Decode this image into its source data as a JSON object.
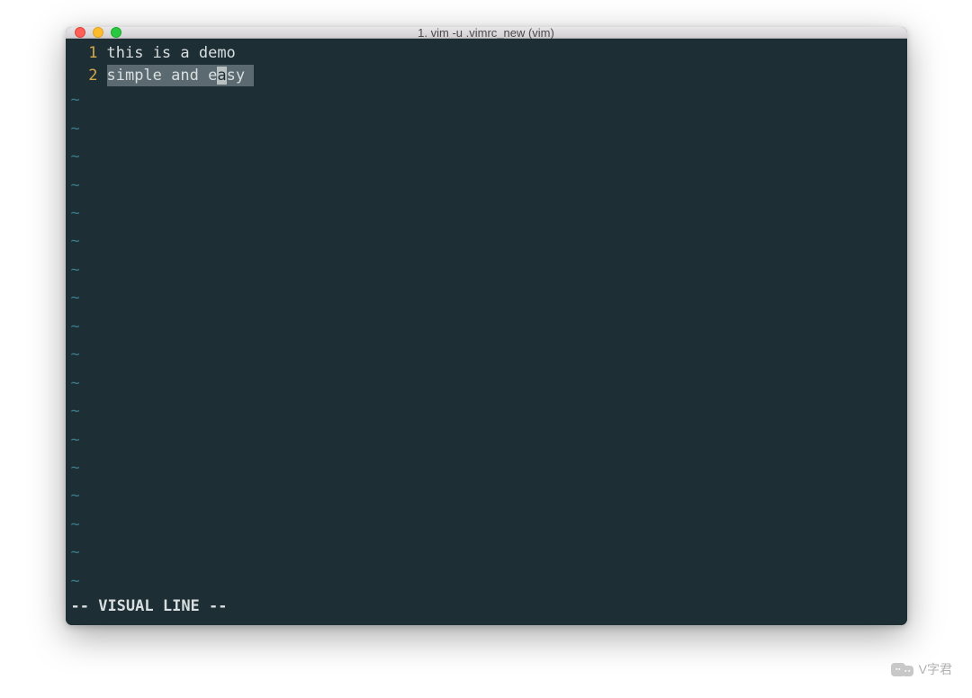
{
  "window": {
    "title": "1. vim -u .vimrc_new (vim)"
  },
  "editor": {
    "lines": [
      {
        "number": "1",
        "text": "this is a demo",
        "selected": false
      },
      {
        "number": "2",
        "text": "simple and easy",
        "selected": true,
        "cursor_col": 12
      }
    ],
    "tilde_count": 18,
    "tilde_char": "~"
  },
  "status": {
    "mode_text": "-- VISUAL LINE --"
  },
  "watermark": {
    "text": "V字君"
  }
}
